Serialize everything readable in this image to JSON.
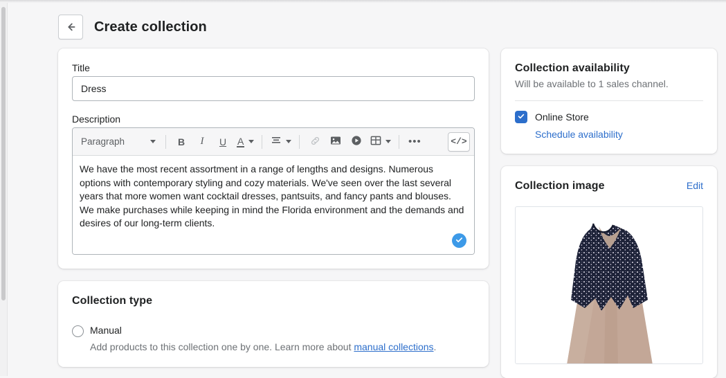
{
  "header": {
    "back_icon": "arrow-left-icon",
    "title": "Create collection"
  },
  "form": {
    "title_label": "Title",
    "title_value": "Dress",
    "title_placeholder": "e.g. Summer collection, Under $100, Staff picks",
    "description_label": "Description",
    "description_text": "We have the most recent assortment in a range of lengths and designs. Numerous options with contemporary styling and cozy materials. We've seen over the last several years that more women want cocktail dresses, pantsuits, and fancy pants and blouses. We make purchases while keeping in mind the Florida environment and the demands and desires of our long-term clients."
  },
  "editor_toolbar": {
    "format_select": "Paragraph",
    "buttons": [
      {
        "name": "bold-icon",
        "label": "B"
      },
      {
        "name": "italic-icon",
        "label": "I"
      },
      {
        "name": "underline-icon",
        "label": "U"
      },
      {
        "name": "text-color-icon",
        "label": "A"
      },
      {
        "name": "align-icon",
        "label": "align"
      },
      {
        "name": "link-icon",
        "label": "link"
      },
      {
        "name": "image-icon",
        "label": "image"
      },
      {
        "name": "video-icon",
        "label": "video"
      },
      {
        "name": "table-icon",
        "label": "table"
      },
      {
        "name": "more-icon",
        "label": "..."
      },
      {
        "name": "code-view-icon",
        "label": "</>"
      }
    ],
    "more_label": "•••",
    "code_label": "</>",
    "bold_label": "B",
    "italic_label": "I",
    "underline_label": "U",
    "font_color_label": "A",
    "status_icon": "check-circle-icon"
  },
  "collection_type": {
    "heading": "Collection type",
    "manual_label": "Manual",
    "manual_help_before": "Add products to this collection one by one. Learn more about ",
    "manual_help_link": "manual collections",
    "manual_help_after": "."
  },
  "availability": {
    "heading": "Collection availability",
    "subtitle": "Will be available to 1 sales channel.",
    "channel_label": "Online Store",
    "channel_checked": true,
    "schedule_link": "Schedule availability"
  },
  "collection_image": {
    "heading": "Collection image",
    "edit_label": "Edit",
    "image_alt": "dress-thumbnail"
  },
  "colors": {
    "accent": "#2c6ecb",
    "page_bg": "#f6f6f7",
    "card_bg": "#ffffff",
    "text": "#202223",
    "subdued_text": "#6d7175",
    "border": "#aeb4b9",
    "status_badge": "#3d9ae8"
  }
}
